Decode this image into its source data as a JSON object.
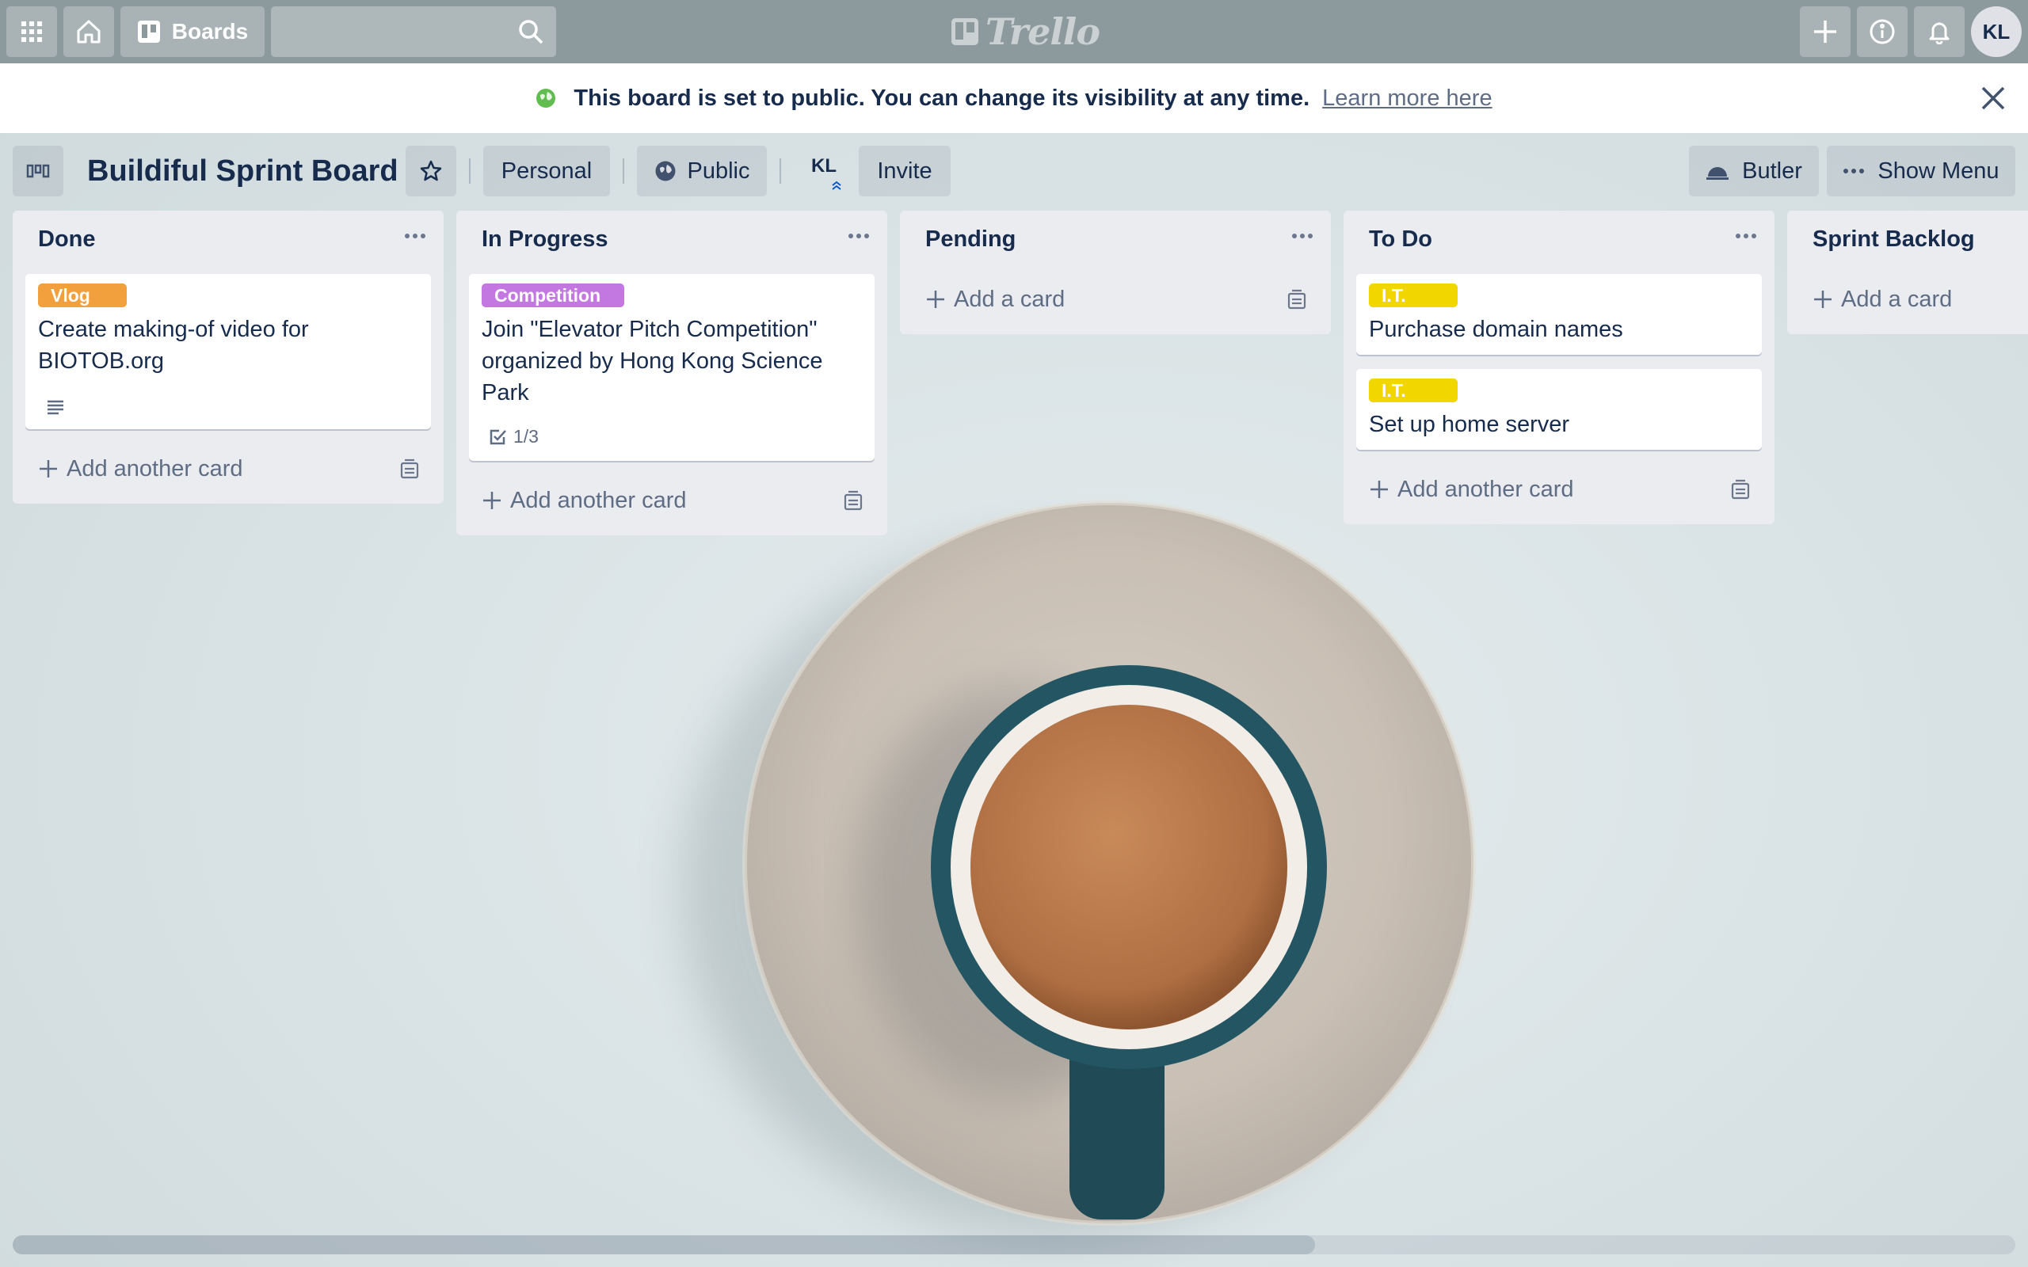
{
  "topbar": {
    "boards_label": "Boards",
    "search_value": "",
    "logo_text": "Trello",
    "user_initials": "KL"
  },
  "banner": {
    "message": "This board is set to public. You can change its visibility at any time.",
    "link": "Learn more here"
  },
  "board": {
    "title": "Buildiful Sprint Board",
    "team": "Personal",
    "visibility": "Public",
    "member_initials": "KL",
    "invite": "Invite",
    "butler": "Butler",
    "show_menu": "Show Menu"
  },
  "lists": [
    {
      "name": "Done",
      "cards": [
        {
          "label": "Vlog",
          "label_color": "#f2a03d",
          "title_line1": "Create making-of video for",
          "title_line2": "BIOTOB.org",
          "has_description": true
        }
      ],
      "add_label": "Add another card"
    },
    {
      "name": "In Progress",
      "cards": [
        {
          "label": "Competition",
          "label_color": "#c377e0",
          "title_line1": "Join \"Elevator Pitch Competition\"",
          "title_line2": "organized by Hong Kong Science",
          "title_line3": "Park",
          "checklist": "1/3"
        }
      ],
      "add_label": "Add another card"
    },
    {
      "name": "Pending",
      "cards": [],
      "add_label": "Add a card"
    },
    {
      "name": "To Do",
      "cards": [
        {
          "label": "I.T.",
          "label_color": "#f2d600",
          "title_line1": "Purchase domain names"
        },
        {
          "label": "I.T.",
          "label_color": "#f2d600",
          "title_line1": "Set up home server"
        }
      ],
      "add_label": "Add another card"
    },
    {
      "name": "Sprint Backlog",
      "cards": [],
      "add_label": "Add a card"
    }
  ],
  "colors": {
    "topbar": "#8c9a9d",
    "list_bg": "#ebecf0",
    "text": "#172b4d",
    "public_globe": "#61bd4f"
  }
}
